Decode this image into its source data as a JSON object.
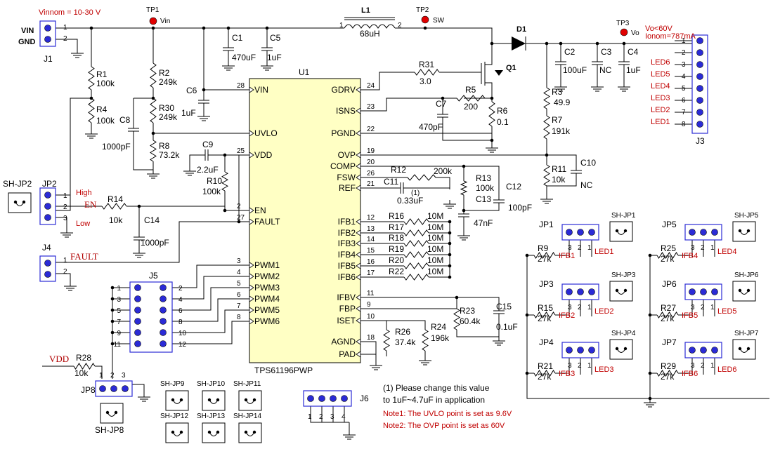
{
  "title_block": {
    "vin_range": "Vinnom = 10-30 V",
    "vo_note1": "Vo<60V",
    "vo_note2": "Ionom=787mA"
  },
  "testpoints": {
    "tp1": "TP1",
    "tp1_net": "Vin",
    "tp2": "TP2",
    "tp2_net": "SW",
    "tp3": "TP3",
    "tp3_net": "Vo"
  },
  "ic": {
    "ref": "U1",
    "part": "TPS61196PWP",
    "left_pins": [
      {
        "num": "28",
        "name": "VIN"
      },
      {
        "num": "",
        "name": "UVLO"
      },
      {
        "num": "25",
        "name": "VDD"
      },
      {
        "num": "2",
        "name": "EN"
      },
      {
        "num": "27",
        "name": "FAULT"
      },
      {
        "num": "3",
        "name": "PWM1"
      },
      {
        "num": "4",
        "name": "PWM2"
      },
      {
        "num": "5",
        "name": "PWM3"
      },
      {
        "num": "6",
        "name": "PWM4"
      },
      {
        "num": "7",
        "name": "PWM5"
      },
      {
        "num": "8",
        "name": "PWM6"
      }
    ],
    "right_pins": [
      {
        "num": "24",
        "name": "GDRV"
      },
      {
        "num": "23",
        "name": "ISNS"
      },
      {
        "num": "22",
        "name": "PGND"
      },
      {
        "num": "19",
        "name": "OVP"
      },
      {
        "num": "20",
        "name": "COMP"
      },
      {
        "num": "26",
        "name": "FSW"
      },
      {
        "num": "21",
        "name": "REF"
      },
      {
        "num": "12",
        "name": "IFB1"
      },
      {
        "num": "13",
        "name": "IFB2"
      },
      {
        "num": "14",
        "name": "IFB3"
      },
      {
        "num": "15",
        "name": "IFB4"
      },
      {
        "num": "16",
        "name": "IFB5"
      },
      {
        "num": "17",
        "name": "IFB6"
      },
      {
        "num": "11",
        "name": "IFBV"
      },
      {
        "num": "9",
        "name": "FBP"
      },
      {
        "num": "10",
        "name": "ISET"
      },
      {
        "num": "18",
        "name": "AGND"
      },
      {
        "num": "",
        "name": "PAD"
      }
    ]
  },
  "parts": {
    "l1": "L1",
    "l1_val": "68uH",
    "l1_p1": "1",
    "l1_p2": "2",
    "d1": "D1",
    "q1": "Q1",
    "c1": "C1",
    "c1_val": "470uF",
    "c5": "C5",
    "c5_val": "1uF",
    "c6": "C6",
    "c6_val": "1uF",
    "c8": "C8",
    "c8_val": "1000pF",
    "c9": "C9",
    "c9_val": "2.2uF",
    "c7": "C7",
    "c7_val": "470pF",
    "c2": "C2",
    "c2_val": "100uF",
    "c3": "C3",
    "c3_val": "NC",
    "c4": "C4",
    "c4_val": "1uF",
    "c10": "C10",
    "c10_val": "NC",
    "c11": "C11",
    "c11_val": "0.33uF",
    "c11_note": "(1)",
    "c12": "C12",
    "c12_val": "100pF",
    "c13": "C13",
    "c13_val": "47nF",
    "c14": "C14",
    "c14_val": "1000pF",
    "c15": "C15",
    "c15_val": "0.1uF",
    "r1": "R1",
    "r1_val": "100k",
    "r4": "R4",
    "r4_val": "100k",
    "r2": "R2",
    "r2_val": "249k",
    "r30": "R30",
    "r30_val": "249k",
    "r8": "R8",
    "r8_val": "73.2k",
    "r10": "R10",
    "r10_val": "100k",
    "r14": "R14",
    "r14_val": "10k",
    "r31": "R31",
    "r31_val": "3.0",
    "r5": "R5",
    "r5_val": "200",
    "r6": "R6",
    "r6_val": "0.1",
    "r3": "R3",
    "r3_val": "49.9",
    "r7": "R7",
    "r7_val": "191k",
    "r11": "R11",
    "r11_val": "10k",
    "r12": "R12",
    "r12_val": "200k",
    "r13": "R13",
    "r13_val": "100k",
    "r16": "R16",
    "r17": "R17",
    "r18": "R18",
    "r19": "R19",
    "r20": "R20",
    "r22": "R22",
    "r_ifb_val": "10M",
    "r23": "R23",
    "r23_val": "60.4k",
    "r26": "R26",
    "r26_val": "37.4k",
    "r24": "R24",
    "r24_val": "196k",
    "r28": "R28",
    "r28_val": "10k",
    "r9": "R9",
    "r15": "R15",
    "r21": "R21",
    "r25": "R25",
    "r27": "R27",
    "r29": "R29",
    "r_led_val": "27k"
  },
  "connectors": {
    "j1": "J1",
    "j1_p1": "VIN",
    "j1_p2": "GND",
    "j2": "JP2",
    "j2_high": "High",
    "j2_en": "EN",
    "j2_low": "Low",
    "sh_jp2": "SH-JP2",
    "j4": "J4",
    "j4_fault": "FAULT",
    "j5": "J5",
    "j5_left": [
      "1",
      "3",
      "5",
      "7",
      "9",
      "11"
    ],
    "j5_right": [
      "2",
      "4",
      "6",
      "8",
      "10",
      "12"
    ],
    "jp8": "JP8",
    "jp8_vdd": "VDD",
    "sh_jp8": "SH-JP8",
    "sh_extra": [
      "SH-JP9",
      "SH-JP10",
      "SH-JP11",
      "SH-JP12",
      "SH-JP13",
      "SH-JP14"
    ],
    "j6": "J6",
    "j6_pins": [
      "1",
      "2",
      "3",
      "4"
    ],
    "j3": "J3",
    "j3_pins": [
      "1",
      "2",
      "3",
      "4",
      "5",
      "6",
      "7",
      "8"
    ],
    "j3_leds": [
      "LED6",
      "LED5",
      "LED4",
      "LED3",
      "LED2",
      "LED1"
    ]
  },
  "led_jumpers": [
    {
      "jp": "JP1",
      "sh": "SH-JP1",
      "r": "R9",
      "ifb": "IFB1",
      "led": "LED1"
    },
    {
      "jp": "JP3",
      "sh": "SH-JP3",
      "r": "R15",
      "ifb": "IFB2",
      "led": "LED2"
    },
    {
      "jp": "JP4",
      "sh": "SH-JP4",
      "r": "R21",
      "ifb": "IFB3",
      "led": "LED3"
    },
    {
      "jp": "JP5",
      "sh": "SH-JP5",
      "r": "R25",
      "ifb": "IFB4",
      "led": "LED4"
    },
    {
      "jp": "JP6",
      "sh": "SH-JP6",
      "r": "R27",
      "ifb": "IFB5",
      "led": "LED5"
    },
    {
      "jp": "JP7",
      "sh": "SH-JP7",
      "r": "R29",
      "ifb": "IFB6",
      "led": "LED6"
    }
  ],
  "jp_pin_labels": [
    "3",
    "2",
    "1"
  ],
  "notes": {
    "n1a": "(1) Please change this value",
    "n1b": "to 1uF~4.7uF in application",
    "n2": "Note1: The UVLO point is set as 9.6V",
    "n3": "Note2: The OVP point is set as 60V"
  }
}
